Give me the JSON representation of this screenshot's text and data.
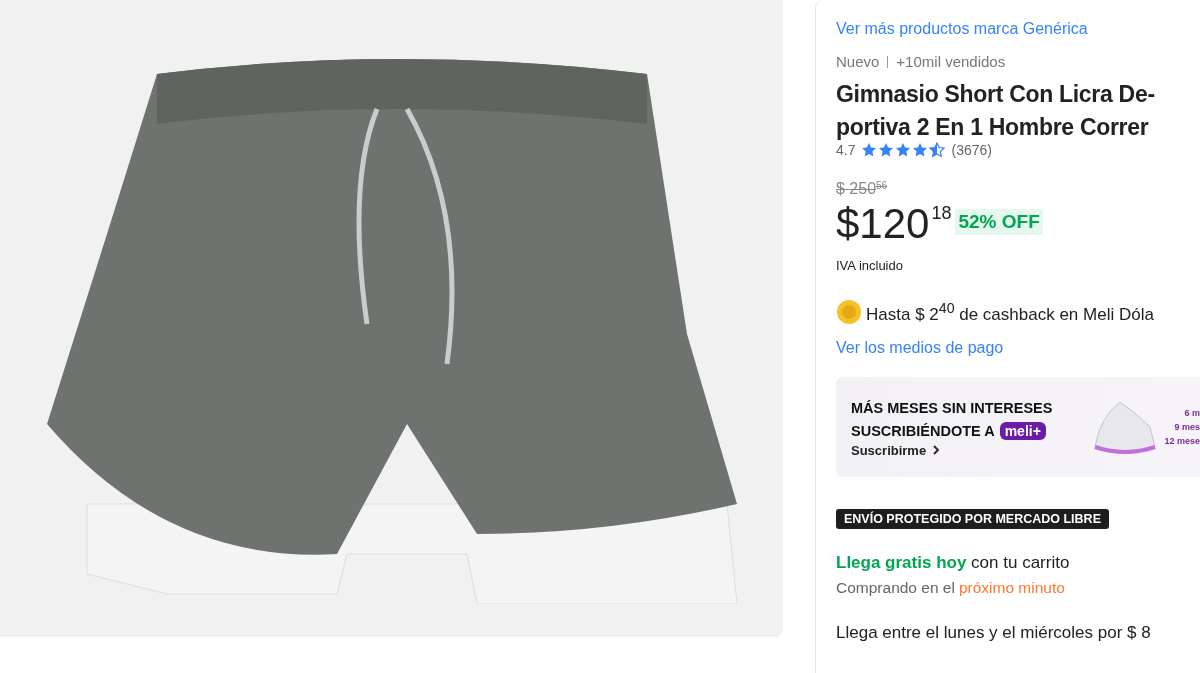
{
  "brand_link": "Ver más productos marca Genérica",
  "condition": "Nuevo",
  "sold": "+10mil vendidos",
  "title": "Gimnasio Short Con Licra De-portiva 2 En 1 Hombre Correr",
  "rating": {
    "value": "4.7",
    "stars": 4.5,
    "count": "(3676)"
  },
  "old_price": {
    "currency": "$",
    "amount": "250",
    "cents": "56"
  },
  "price": {
    "currency": "$",
    "amount": "120",
    "cents": "18",
    "discount": "52% OFF"
  },
  "tax_note": "IVA incluido",
  "cashback": "Hasta $ 2$^{40}$ de cashback en Meli Dóla",
  "payment_link": "Ver los medios de pago",
  "promo": {
    "line_1": "MÁS MESES SIN INTERESES",
    "line_2": "SUSCRIBIÉNDOTE A",
    "logo": "meli+",
    "action": "Suscribirme",
    "image_labels": [
      "6 m",
      "9 mes",
      "12 mese"
    ]
  },
  "shipping_badge": "ENVÍO PROTEGIDO POR MERCADO LIBRE",
  "delivery": "**Llega gratis hoy** con tu carrito",
  "deadline": {
    "prefix": "Comprando en el",
    "highlight": "próximo minuto"
  },
  "alt_delivery": "Llega entre el lunes y el miércoles por $ 8"
}
